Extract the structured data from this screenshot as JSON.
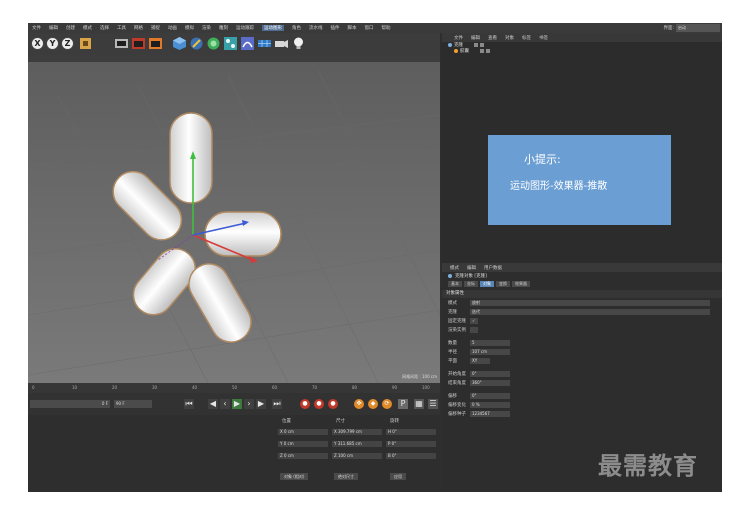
{
  "menubar": {
    "items": [
      "文件",
      "编辑",
      "创建",
      "模式",
      "选择",
      "工具",
      "网格",
      "捕捉",
      "动画",
      "模拟",
      "渲染",
      "雕刻",
      "运动跟踪",
      "运动图形",
      "角色",
      "流水线",
      "插件",
      "脚本",
      "窗口",
      "帮助"
    ],
    "active_index": 13,
    "layout_label": "界面:",
    "layout_value": "启动"
  },
  "toolbar": {
    "axis_x": "X",
    "axis_y": "Y",
    "axis_z": "Z"
  },
  "viewport": {
    "grid_spacing": "网格间距 : 100 cm"
  },
  "object_manager": {
    "tabs": [
      "文件",
      "编辑",
      "查看",
      "对象",
      "标签",
      "书签"
    ],
    "objects": [
      {
        "name": "克隆"
      },
      {
        "name": "胶囊"
      }
    ]
  },
  "tip": {
    "title": "小提示:",
    "body": "运动图形-效果器-推散"
  },
  "attribute_manager": {
    "tabs": [
      "模式",
      "编辑",
      "用户数据"
    ],
    "object_title": "克隆对象 [克隆]",
    "subtabs": [
      "基本",
      "坐标",
      "对象",
      "变换",
      "效果器"
    ],
    "active_subtab": 2,
    "section": "对象属性",
    "rows": [
      {
        "label": "模式",
        "value": "放射"
      },
      {
        "label": "克隆",
        "value": "迭代"
      },
      {
        "label": "固定克隆",
        "value": "✓"
      },
      {
        "label": "渲染实例",
        "value": ""
      },
      {
        "label": "数量",
        "value": "5"
      },
      {
        "label": "半径",
        "value": "107 cm"
      },
      {
        "label": "平面",
        "value": "XY"
      },
      {
        "label": "开始角度",
        "value": "0°"
      },
      {
        "label": "结束角度",
        "value": "360°"
      },
      {
        "label": "偏移",
        "value": "0°"
      },
      {
        "label": "偏移变化",
        "value": "0 %"
      },
      {
        "label": "偏移种子",
        "value": "1234567"
      }
    ]
  },
  "timeline": {
    "ticks": [
      "0",
      "10",
      "20",
      "30",
      "40",
      "50",
      "60",
      "70",
      "80",
      "90",
      "100"
    ],
    "frame_current": "0 F",
    "frame_end": "90 F"
  },
  "coordinates": {
    "headers": [
      "位置",
      "尺寸",
      "旋转"
    ],
    "rows": [
      [
        "X  0 cm",
        "X  309.799 cm",
        "H  0°"
      ],
      [
        "Y  0 cm",
        "Y  311.685 cm",
        "P  0°"
      ],
      [
        "Z  0 cm",
        "Z  100 cm",
        "B  0°"
      ]
    ],
    "mode_button": "对象 (相对)",
    "size_button": "绝对尺寸",
    "apply_button": "应用"
  },
  "watermark": "最需教育",
  "colors": {
    "tip_background": "#6b9fd4",
    "active_tab": "#5884b6",
    "record": "#c0392b",
    "key": "#e08b2a"
  }
}
